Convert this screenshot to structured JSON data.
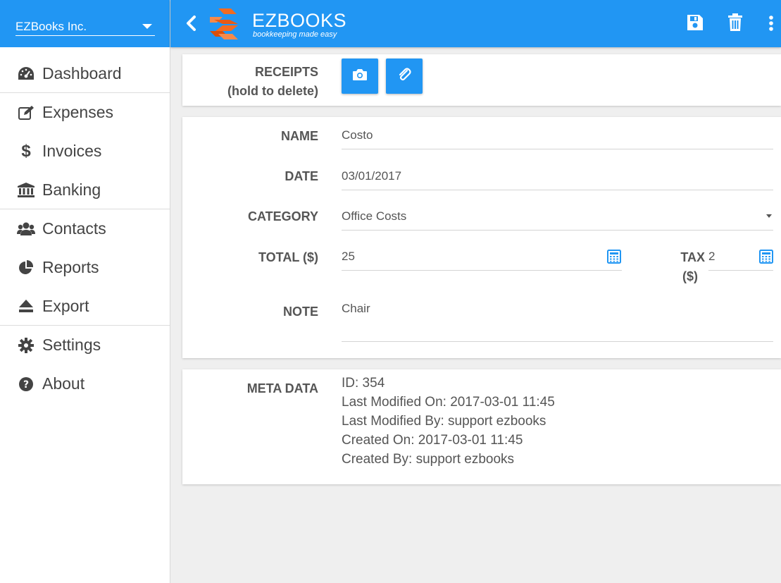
{
  "sidebar": {
    "company": "EZBooks Inc.",
    "items": [
      {
        "label": "Dashboard",
        "icon": "dashboard-icon"
      },
      {
        "label": "Expenses",
        "icon": "edit-icon"
      },
      {
        "label": "Invoices",
        "icon": "dollar-icon"
      },
      {
        "label": "Banking",
        "icon": "bank-icon"
      },
      {
        "label": "Contacts",
        "icon": "users-icon"
      },
      {
        "label": "Reports",
        "icon": "pie-chart-icon"
      },
      {
        "label": "Export",
        "icon": "eject-icon"
      },
      {
        "label": "Settings",
        "icon": "gear-icon"
      },
      {
        "label": "About",
        "icon": "question-circle-icon"
      }
    ]
  },
  "header": {
    "brand": "EZBOOKS",
    "tagline": "bookkeeping made easy",
    "icons": [
      "back-icon",
      "save-icon",
      "trash-icon",
      "more-vert-icon"
    ]
  },
  "receipts": {
    "label_line1": "RECEIPTS",
    "label_line2": "(hold to delete)",
    "buttons": [
      "camera-icon",
      "paperclip-icon"
    ]
  },
  "form": {
    "name_label": "NAME",
    "name_value": "Costo",
    "date_label": "DATE",
    "date_value": "03/01/2017",
    "category_label": "CATEGORY",
    "category_value": "Office Costs",
    "total_label": "TOTAL ($)",
    "total_value": "25",
    "tax_label_line1": "TAX",
    "tax_label_line2": "($)",
    "tax_value": "2",
    "note_label": "NOTE",
    "note_value": "Chair"
  },
  "meta": {
    "label": "META DATA",
    "lines": [
      "ID: 354",
      "Last Modified On: 2017-03-01 11:45",
      "Last Modified By: support ezbooks",
      "Created On: 2017-03-01 11:45",
      "Created By: support ezbooks"
    ]
  },
  "colors": {
    "primary": "#2196f3",
    "logo_orange": "#f26b21",
    "text": "#444444"
  }
}
